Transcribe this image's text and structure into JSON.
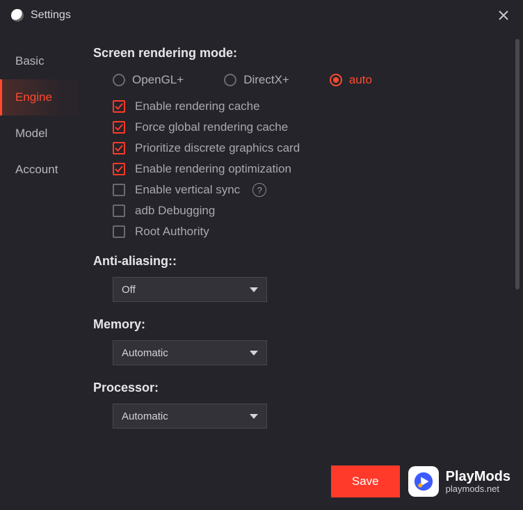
{
  "titlebar": {
    "title": "Settings"
  },
  "sidebar": {
    "tabs": [
      {
        "label": "Basic",
        "active": false
      },
      {
        "label": "Engine",
        "active": true
      },
      {
        "label": "Model",
        "active": false
      },
      {
        "label": "Account",
        "active": false
      }
    ]
  },
  "engine": {
    "section_title": "Screen rendering mode:",
    "radios": [
      {
        "label": "OpenGL+",
        "checked": false
      },
      {
        "label": "DirectX+",
        "checked": false
      },
      {
        "label": "auto",
        "checked": true
      }
    ],
    "checks": [
      {
        "label": "Enable rendering cache",
        "checked": true,
        "help": false
      },
      {
        "label": "Force global rendering cache",
        "checked": true,
        "help": false
      },
      {
        "label": "Prioritize discrete graphics card",
        "checked": true,
        "help": false
      },
      {
        "label": "Enable rendering optimization",
        "checked": true,
        "help": false
      },
      {
        "label": "Enable vertical sync",
        "checked": false,
        "help": true
      },
      {
        "label": "adb Debugging",
        "checked": false,
        "help": false
      },
      {
        "label": "Root Authority",
        "checked": false,
        "help": false
      }
    ],
    "antialias_label": "Anti-aliasing::",
    "antialias_value": "Off",
    "memory_label": "Memory:",
    "memory_value": "Automatic",
    "processor_label": "Processor:",
    "processor_value": "Automatic"
  },
  "footer": {
    "save_label": "Save",
    "brand_title": "PlayMods",
    "brand_sub": "playmods.net"
  },
  "colors": {
    "accent": "#ff3a2a",
    "bg": "#25242a"
  }
}
